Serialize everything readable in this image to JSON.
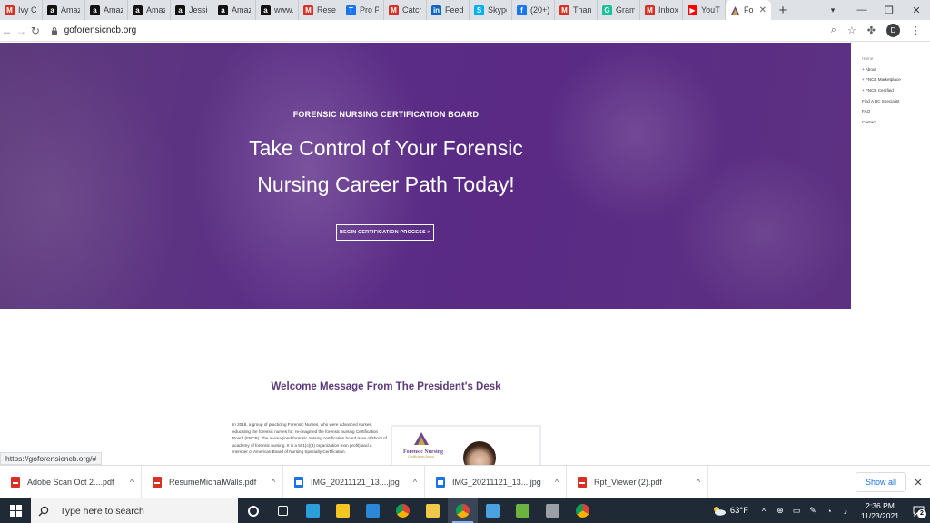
{
  "browser": {
    "tabs": [
      {
        "label": "Ivy Ch",
        "favicon_color": "#d93025",
        "favicon_glyph": "M"
      },
      {
        "label": "Amaz",
        "favicon_color": "#111111",
        "favicon_glyph": "a"
      },
      {
        "label": "Amaz",
        "favicon_color": "#111111",
        "favicon_glyph": "a"
      },
      {
        "label": "Amaz",
        "favicon_color": "#111111",
        "favicon_glyph": "a"
      },
      {
        "label": "Jessic",
        "favicon_color": "#111111",
        "favicon_glyph": "a"
      },
      {
        "label": "Amaz",
        "favicon_color": "#111111",
        "favicon_glyph": "a"
      },
      {
        "label": "www.",
        "favicon_color": "#111111",
        "favicon_glyph": "a"
      },
      {
        "label": "Reset",
        "favicon_color": "#d93025",
        "favicon_glyph": "M"
      },
      {
        "label": "Pro P",
        "favicon_color": "#1a73e8",
        "favicon_glyph": "T"
      },
      {
        "label": "Catch",
        "favicon_color": "#d93025",
        "favicon_glyph": "M"
      },
      {
        "label": "Feed",
        "favicon_color": "#0a66c2",
        "favicon_glyph": "in"
      },
      {
        "label": "Skype",
        "favicon_color": "#00aff0",
        "favicon_glyph": "S"
      },
      {
        "label": "(20+)",
        "favicon_color": "#1877f2",
        "favicon_glyph": "f"
      },
      {
        "label": "Thank",
        "favicon_color": "#d93025",
        "favicon_glyph": "M"
      },
      {
        "label": "Gram",
        "favicon_color": "#15c39a",
        "favicon_glyph": "G"
      },
      {
        "label": "Inbox",
        "favicon_color": "#d93025",
        "favicon_glyph": "M"
      },
      {
        "label": "YouTu",
        "favicon_color": "#ff0000",
        "favicon_glyph": "▶"
      }
    ],
    "active_tab": {
      "label": "Fo",
      "favicon_color": "#6b4a8c"
    },
    "new_tab_glyph": "+",
    "window_controls": [
      "▾",
      "—",
      "❐",
      "✕"
    ],
    "url": "goforensicncb.org",
    "avatar_initial": "D"
  },
  "site": {
    "nav": [
      {
        "label": "Home",
        "dim": true
      },
      {
        "label": "+ About",
        "dim": false
      },
      {
        "label": "+ FNCB Marketplace",
        "dim": false
      },
      {
        "label": "+ FNCB Certified",
        "dim": false
      },
      {
        "label": "Find A BC Specialist",
        "dim": false
      },
      {
        "label": "FAQ",
        "dim": false
      },
      {
        "label": "Contact",
        "dim": false
      }
    ],
    "close_glyph": "✕",
    "hero": {
      "eyebrow": "FORENSIC NURSING CERTIFICATION BOARD",
      "title_line1": "Take Control of Your Forensic",
      "title_line2": "Nursing Career Path Today!",
      "cta": "BEGIN CERTIFICATION PROCESS >"
    },
    "section_title": "Welcome Message From The President's Desk",
    "president_text": "In 2018, a group of practicing Forensic Nurses, who were advanced nurses, educating the forensic nurses for, re-imagined the forensic nursing Certification Board (FNCB). The re-imagined forensic nursing certification board is an offshoot of academy of forensic nursing. It is a 501(c)(3) organization (non profit) and a member of American Board of Nursing Specialty Certification.",
    "card_logo_title": "Forensic Nursing",
    "card_logo_sub": "Certification Board"
  },
  "status_url": "https://goforensicncb.org/#",
  "downloads": {
    "items": [
      {
        "name": "Adobe Scan Oct 2....pdf",
        "type": "pdf"
      },
      {
        "name": "ResumeMichalWalls.pdf",
        "type": "pdf"
      },
      {
        "name": "IMG_20211121_13....jpg",
        "type": "img"
      },
      {
        "name": "IMG_20211121_13....jpg",
        "type": "img"
      },
      {
        "name": "Rpt_Viewer (2).pdf",
        "type": "pdf"
      }
    ],
    "show_all": "Show all"
  },
  "taskbar": {
    "search_placeholder": "Type here to search",
    "weather": "63°F",
    "time": "2:36 PM",
    "date": "11/23/2021",
    "notification_count": "2",
    "pinned": [
      {
        "name": "cortana",
        "color": "#ffffff"
      },
      {
        "name": "task-view",
        "color": "#ffffff"
      },
      {
        "name": "edge",
        "color": "#2b9fd9"
      },
      {
        "name": "store",
        "color": "#f3c623"
      },
      {
        "name": "mail",
        "color": "#2b88d8"
      },
      {
        "name": "chrome",
        "color": "#db4437"
      },
      {
        "name": "file-explorer",
        "color": "#f0c94a"
      },
      {
        "name": "chrome-active",
        "color": "#34a853"
      },
      {
        "name": "app-blue",
        "color": "#4aa3df"
      },
      {
        "name": "app-layers",
        "color": "#6cb33f"
      },
      {
        "name": "app-gear",
        "color": "#9aa0a6"
      },
      {
        "name": "chrome-2",
        "color": "#fbbc05"
      }
    ]
  }
}
